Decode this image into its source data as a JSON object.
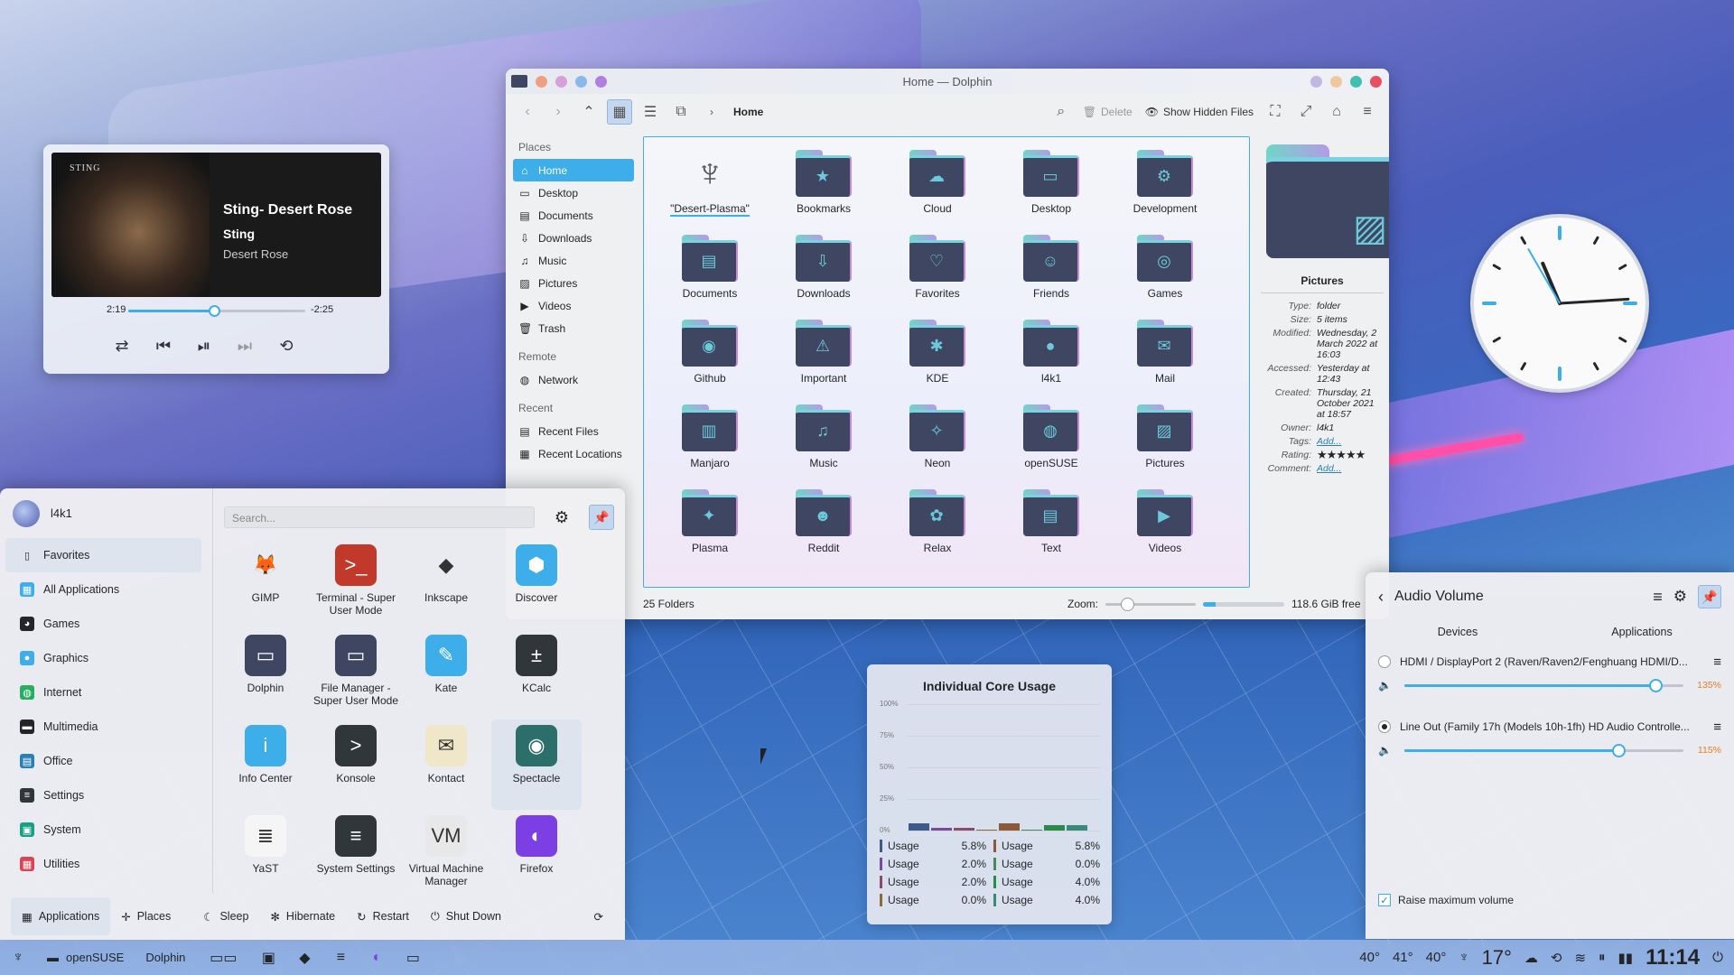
{
  "colors": {
    "accent": "#3daee9",
    "warning": "#e67e22"
  },
  "media": {
    "cover_text": "STING",
    "title": "Sting- Desert Rose",
    "artist": "Sting",
    "album": "Desert Rose",
    "elapsed": "2:19",
    "remaining": "-2:25",
    "progress": 0.49,
    "controls": [
      "shuffle-icon",
      "previous-icon",
      "play-icon",
      "next-icon",
      "repeat-icon"
    ]
  },
  "dolphin": {
    "title": "Home — Dolphin",
    "breadcrumb": "Home",
    "toolbar": {
      "delete": "Delete",
      "show_hidden": "Show Hidden Files"
    },
    "places": {
      "header_places": "Places",
      "places": [
        {
          "label": "Home",
          "icon": "home-icon"
        },
        {
          "label": "Desktop",
          "icon": "desktop-icon"
        },
        {
          "label": "Documents",
          "icon": "documents-icon"
        },
        {
          "label": "Downloads",
          "icon": "downloads-icon"
        },
        {
          "label": "Music",
          "icon": "music-icon"
        },
        {
          "label": "Pictures",
          "icon": "pictures-icon"
        },
        {
          "label": "Videos",
          "icon": "videos-icon"
        },
        {
          "label": "Trash",
          "icon": "trash-icon"
        }
      ],
      "header_remote": "Remote",
      "remote": [
        {
          "label": "Network",
          "icon": "network-icon"
        }
      ],
      "header_recent": "Recent",
      "recent": [
        {
          "label": "Recent Files",
          "icon": "recent-files-icon"
        },
        {
          "label": "Recent Locations",
          "icon": "recent-locations-icon"
        }
      ]
    },
    "folders": [
      {
        "label": "\"Desert-Plasma\"",
        "glyph": "♆"
      },
      {
        "label": "Bookmarks",
        "glyph": "★"
      },
      {
        "label": "Cloud",
        "glyph": "☁"
      },
      {
        "label": "Desktop",
        "glyph": "▭"
      },
      {
        "label": "Development",
        "glyph": "⚙"
      },
      {
        "label": "Documents",
        "glyph": "▤"
      },
      {
        "label": "Downloads",
        "glyph": "⇩"
      },
      {
        "label": "Favorites",
        "glyph": "♡"
      },
      {
        "label": "Friends",
        "glyph": "☺"
      },
      {
        "label": "Games",
        "glyph": "◎"
      },
      {
        "label": "Github",
        "glyph": "◉"
      },
      {
        "label": "Important",
        "glyph": "⚠"
      },
      {
        "label": "KDE",
        "glyph": "✱"
      },
      {
        "label": "l4k1",
        "glyph": "●"
      },
      {
        "label": "Mail",
        "glyph": "✉"
      },
      {
        "label": "Manjaro",
        "glyph": "▥"
      },
      {
        "label": "Music",
        "glyph": "♫"
      },
      {
        "label": "Neon",
        "glyph": "✧"
      },
      {
        "label": "openSUSE",
        "glyph": "◍"
      },
      {
        "label": "Pictures",
        "glyph": "▨"
      },
      {
        "label": "Plasma",
        "glyph": "✦"
      },
      {
        "label": "Reddit",
        "glyph": "☻"
      },
      {
        "label": "Relax",
        "glyph": "✿"
      },
      {
        "label": "Text",
        "glyph": "▤"
      },
      {
        "label": "Videos",
        "glyph": "▶"
      }
    ],
    "info": {
      "name": "Pictures",
      "rows": [
        {
          "k": "Type:",
          "v": "folder"
        },
        {
          "k": "Size:",
          "v": "5 items"
        },
        {
          "k": "Modified:",
          "v": "Wednesday, 2 March 2022 at 16:03"
        },
        {
          "k": "Accessed:",
          "v": "Yesterday at 12:43"
        },
        {
          "k": "Created:",
          "v": "Thursday, 21 October 2021 at 18:57"
        },
        {
          "k": "Owner:",
          "v": "l4k1"
        }
      ],
      "tags_label": "Tags:",
      "tags_value": "Add...",
      "rating_label": "Rating:",
      "rating": 5,
      "comment_label": "Comment:",
      "comment_value": "Add..."
    },
    "status": {
      "count": "25 Folders",
      "zoom_label": "Zoom:",
      "free": "118.6 GiB free",
      "free_used_fraction": 0.15,
      "zoom_fraction": 0.2
    }
  },
  "clock": {
    "hour": 11,
    "minute": 14,
    "second": 25
  },
  "launcher": {
    "user": "l4k1",
    "search_placeholder": "Search...",
    "categories": [
      {
        "label": "Favorites",
        "icon": "bookmark-icon",
        "color": "transparent",
        "glyph": "▯"
      },
      {
        "label": "All Applications",
        "icon": "all-apps-icon",
        "color": "#3daee9",
        "glyph": "▦"
      },
      {
        "label": "Games",
        "icon": "games-icon",
        "color": "#232629",
        "glyph": "◕"
      },
      {
        "label": "Graphics",
        "icon": "graphics-icon",
        "color": "#3daee9",
        "glyph": "●"
      },
      {
        "label": "Internet",
        "icon": "internet-icon",
        "color": "#27ae60",
        "glyph": "◍"
      },
      {
        "label": "Multimedia",
        "icon": "multimedia-icon",
        "color": "#232629",
        "glyph": "▬"
      },
      {
        "label": "Office",
        "icon": "office-icon",
        "color": "#2980b9",
        "glyph": "▤"
      },
      {
        "label": "Settings",
        "icon": "settings-icon",
        "color": "#31363b",
        "glyph": "≡"
      },
      {
        "label": "System",
        "icon": "system-icon",
        "color": "#16a085",
        "glyph": "▣"
      },
      {
        "label": "Utilities",
        "icon": "utilities-icon",
        "color": "#da4453",
        "glyph": "▦"
      }
    ],
    "apps": [
      {
        "label": "GIMP",
        "icon": "gimp-icon",
        "bg": "transparent",
        "glyph": "🦊"
      },
      {
        "label": "Terminal - Super User Mode",
        "icon": "terminal-su-icon",
        "bg": "#c0392b",
        "glyph": ">_"
      },
      {
        "label": "Inkscape",
        "icon": "inkscape-icon",
        "bg": "transparent",
        "glyph": "◆"
      },
      {
        "label": "Discover",
        "icon": "discover-icon",
        "bg": "#3daee9",
        "glyph": "⬢"
      },
      {
        "label": "Dolphin",
        "icon": "dolphin-icon",
        "bg": "#3e4661",
        "glyph": "▭"
      },
      {
        "label": "File Manager - Super User Mode",
        "icon": "file-manager-su-icon",
        "bg": "#3e4661",
        "glyph": "▭"
      },
      {
        "label": "Kate",
        "icon": "kate-icon",
        "bg": "#3daee9",
        "glyph": "✎"
      },
      {
        "label": "KCalc",
        "icon": "kcalc-icon",
        "bg": "#31363b",
        "glyph": "±"
      },
      {
        "label": "Info Center",
        "icon": "info-center-icon",
        "bg": "#3daee9",
        "glyph": "i"
      },
      {
        "label": "Konsole",
        "icon": "konsole-icon",
        "bg": "#31363b",
        "glyph": ">"
      },
      {
        "label": "Kontact",
        "icon": "kontact-icon",
        "bg": "#f0e6c8",
        "glyph": "✉"
      },
      {
        "label": "Spectacle",
        "icon": "spectacle-icon",
        "bg": "#2c6e69",
        "glyph": "◉"
      },
      {
        "label": "YaST",
        "icon": "yast-icon",
        "bg": "#f5f5f5",
        "glyph": "≣"
      },
      {
        "label": "System Settings",
        "icon": "system-settings-icon",
        "bg": "#31363b",
        "glyph": "≡"
      },
      {
        "label": "Virtual Machine Manager",
        "icon": "vmm-icon",
        "bg": "#e8e8e8",
        "glyph": "VM"
      },
      {
        "label": "Firefox",
        "icon": "firefox-icon",
        "bg": "#7b3fe4",
        "glyph": "◐"
      }
    ],
    "footer": {
      "applications": "Applications",
      "places": "Places",
      "sleep": "Sleep",
      "hibernate": "Hibernate",
      "restart": "Restart",
      "shutdown": "Shut Down"
    }
  },
  "cores": {
    "title": "Individual Core Usage",
    "chart_data": {
      "type": "bar",
      "title": "Individual Core Usage",
      "ticks": [
        "100%",
        "75%",
        "50%",
        "25%",
        "0%"
      ],
      "ylim": [
        0,
        100
      ],
      "series": [
        {
          "name": "Usage",
          "value": 5.8,
          "color": "#3e5a8a"
        },
        {
          "name": "Usage",
          "value": 2.0,
          "color": "#7a4a9a"
        },
        {
          "name": "Usage",
          "value": 2.0,
          "color": "#8a4a6a"
        },
        {
          "name": "Usage",
          "value": 0.0,
          "color": "#8a6a3a"
        },
        {
          "name": "Usage",
          "value": 5.8,
          "color": "#8a5a3a"
        },
        {
          "name": "Usage",
          "value": 0.0,
          "color": "#4a8a5a"
        },
        {
          "name": "Usage",
          "value": 4.0,
          "color": "#2a8a4a"
        },
        {
          "name": "Usage",
          "value": 4.0,
          "color": "#3a8a7a"
        }
      ]
    },
    "legend": [
      {
        "name": "Usage",
        "value": "5.8%",
        "color": "#3e5a8a"
      },
      {
        "name": "Usage",
        "value": "2.0%",
        "color": "#7a4a9a"
      },
      {
        "name": "Usage",
        "value": "2.0%",
        "color": "#8a4a6a"
      },
      {
        "name": "Usage",
        "value": "0.0%",
        "color": "#8a6a3a"
      },
      {
        "name": "Usage",
        "value": "5.8%",
        "color": "#8a5a3a"
      },
      {
        "name": "Usage",
        "value": "0.0%",
        "color": "#4a8a5a"
      },
      {
        "name": "Usage",
        "value": "4.0%",
        "color": "#2a8a4a"
      },
      {
        "name": "Usage",
        "value": "4.0%",
        "color": "#3a8a7a"
      }
    ]
  },
  "audio": {
    "title": "Audio Volume",
    "tabs": [
      "Devices",
      "Applications"
    ],
    "devices": [
      {
        "name": "HDMI / DisplayPort 2 (Raven/Raven2/Fenghuang HDMI/D...",
        "level": 1.35,
        "pct": "135%",
        "selected": false
      },
      {
        "name": "Line Out (Family 17h (Models 10h-1fh) HD Audio Controlle...",
        "level": 1.15,
        "pct": "115%",
        "selected": true
      }
    ],
    "raise_label": "Raise maximum volume",
    "raise_checked": true
  },
  "panel": {
    "tasks": [
      {
        "label": "openSUSE"
      },
      {
        "label": "Dolphin"
      }
    ],
    "temps": [
      "40°",
      "41°",
      "40°"
    ],
    "weather_temp": "17°",
    "time": "11:14"
  }
}
